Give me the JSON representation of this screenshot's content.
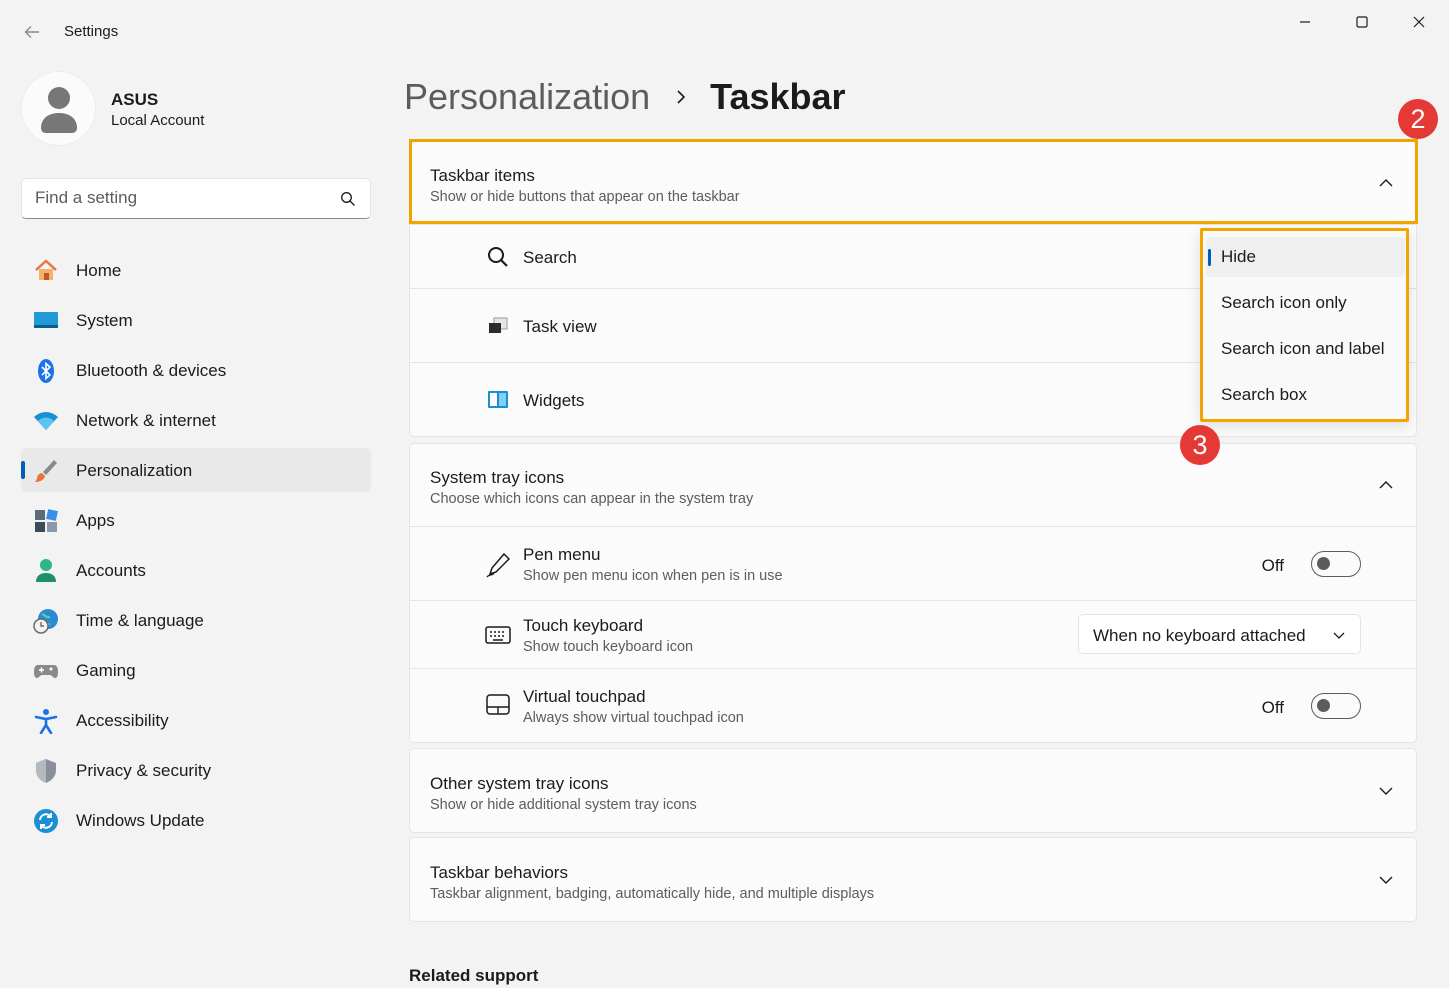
{
  "window": {
    "title": "Settings"
  },
  "user": {
    "name": "ASUS",
    "account_type": "Local Account"
  },
  "search": {
    "placeholder": "Find a setting"
  },
  "sidebar": {
    "items": [
      {
        "label": "Home",
        "icon": "home-icon"
      },
      {
        "label": "System",
        "icon": "system-icon"
      },
      {
        "label": "Bluetooth & devices",
        "icon": "bluetooth-icon"
      },
      {
        "label": "Network & internet",
        "icon": "wifi-icon"
      },
      {
        "label": "Personalization",
        "icon": "paintbrush-icon",
        "active": true
      },
      {
        "label": "Apps",
        "icon": "apps-icon"
      },
      {
        "label": "Accounts",
        "icon": "person-icon"
      },
      {
        "label": "Time & language",
        "icon": "globe-clock-icon"
      },
      {
        "label": "Gaming",
        "icon": "gamepad-icon"
      },
      {
        "label": "Accessibility",
        "icon": "accessibility-icon"
      },
      {
        "label": "Privacy & security",
        "icon": "shield-icon"
      },
      {
        "label": "Windows Update",
        "icon": "update-icon"
      }
    ]
  },
  "breadcrumb": {
    "parent": "Personalization",
    "current": "Taskbar"
  },
  "taskbar_items": {
    "title": "Taskbar items",
    "subtitle": "Show or hide buttons that appear on the taskbar",
    "rows": [
      {
        "label": "Search",
        "icon": "search-icon"
      },
      {
        "label": "Task view",
        "icon": "task-view-icon"
      },
      {
        "label": "Widgets",
        "icon": "widgets-icon"
      }
    ]
  },
  "search_menu": {
    "options": [
      "Hide",
      "Search icon only",
      "Search icon and label",
      "Search box"
    ],
    "selected": "Hide"
  },
  "system_tray": {
    "title": "System tray icons",
    "subtitle": "Choose which icons can appear in the system tray",
    "pen_menu": {
      "label": "Pen menu",
      "subtitle": "Show pen menu icon when pen is in use",
      "state": "Off"
    },
    "touch_keyboard": {
      "label": "Touch keyboard",
      "subtitle": "Show touch keyboard icon",
      "value": "When no keyboard attached"
    },
    "virtual_touchpad": {
      "label": "Virtual touchpad",
      "subtitle": "Always show virtual touchpad icon",
      "state": "Off"
    }
  },
  "other_tray": {
    "title": "Other system tray icons",
    "subtitle": "Show or hide additional system tray icons"
  },
  "behaviors": {
    "title": "Taskbar behaviors",
    "subtitle": "Taskbar alignment, badging, automatically hide, and multiple displays"
  },
  "related": {
    "title": "Related support"
  },
  "annotations": {
    "step_2": "2",
    "step_3": "3",
    "highlight_color": "#f0a500",
    "badge_color": "#e53935"
  },
  "colors": {
    "accent": "#005fb8"
  }
}
